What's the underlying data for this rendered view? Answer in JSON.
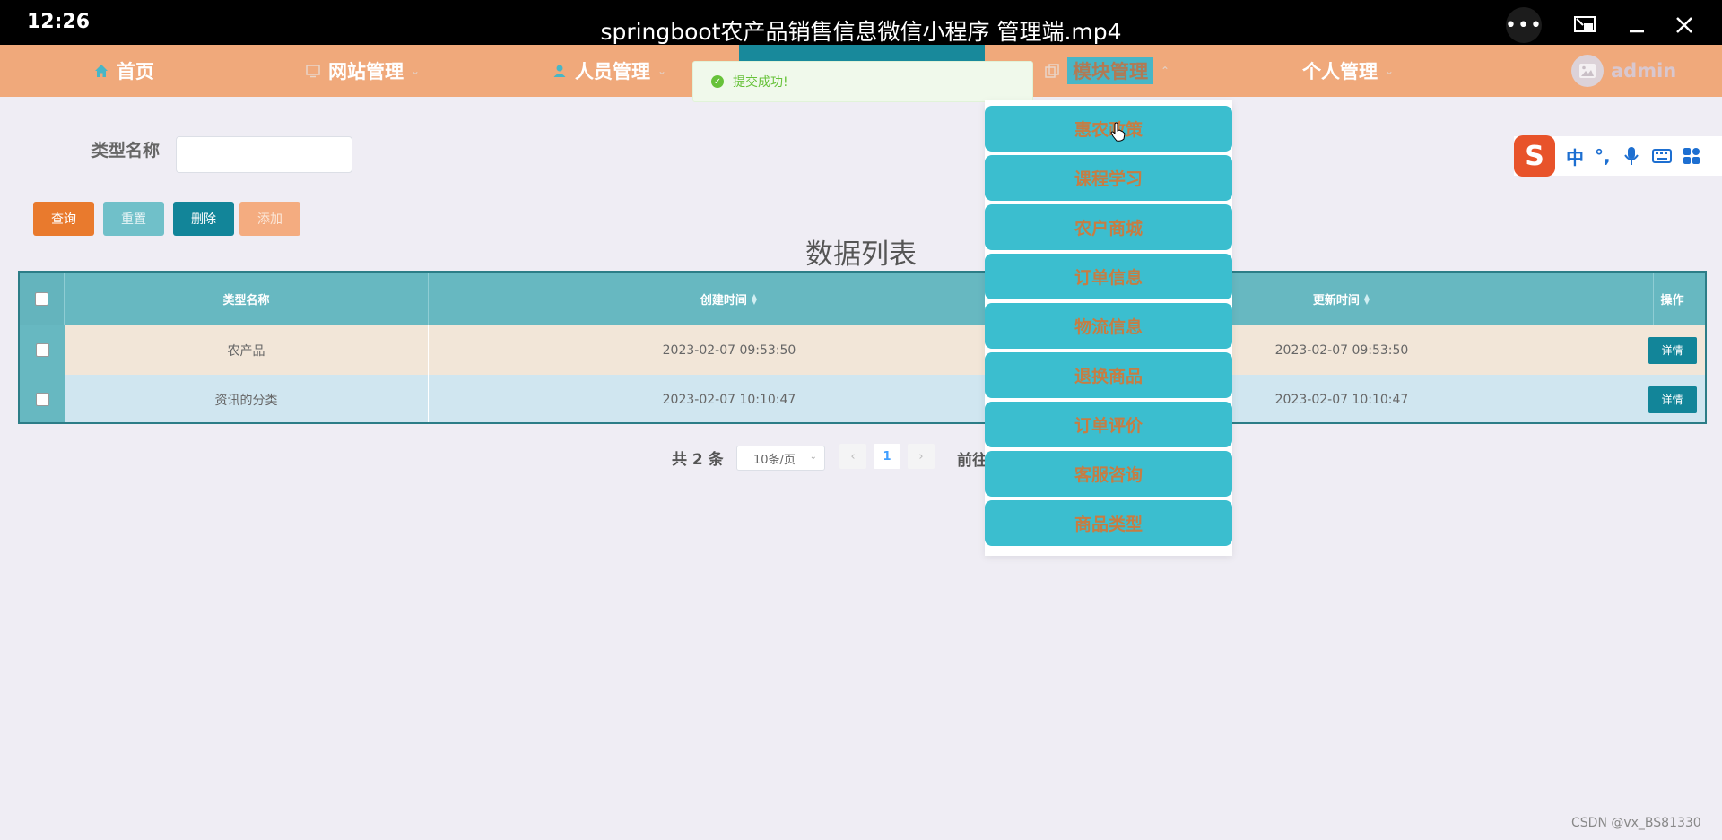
{
  "player": {
    "time": "12:26",
    "title": "springboot农产品销售信息微信小程序 管理端.mp4",
    "more_icon": "more-icon",
    "pip_icon": "picture-in-picture-icon",
    "minimize_icon": "minimize-icon",
    "close_icon": "close-icon"
  },
  "nav": {
    "items": [
      {
        "label": "首页",
        "icon": "home-icon"
      },
      {
        "label": "网站管理",
        "icon": "monitor-icon"
      },
      {
        "label": "人员管理",
        "icon": "user-icon"
      },
      {
        "label": "模块管理",
        "icon": "copy-icon"
      },
      {
        "label": "个人管理",
        "icon": ""
      }
    ],
    "user": "admin",
    "colors": {
      "bar": "#f0a97b",
      "active": "#18899b"
    }
  },
  "toast": {
    "text": "提交成功!"
  },
  "search": {
    "label": "类型名称",
    "value": ""
  },
  "buttons": {
    "query": "查询",
    "reset": "重置",
    "delete": "删除",
    "add": "添加"
  },
  "list_title": "数据列表",
  "table": {
    "headers": [
      "类型名称",
      "创建时间",
      "更新时间",
      "操作"
    ],
    "rows": [
      {
        "name": "农产品",
        "created": "2023-02-07 09:53:50",
        "updated": "2023-02-07 09:53:50",
        "action": "详情"
      },
      {
        "name": "资讯的分类",
        "created": "2023-02-07 10:10:47",
        "updated": "2023-02-07 10:10:47",
        "action": "详情"
      }
    ]
  },
  "pagination": {
    "total": "共 2 条",
    "page_size": "10条/页",
    "current": "1",
    "goto": "前往"
  },
  "dropdown": {
    "items": [
      "惠农政策",
      "课程学习",
      "农户商城",
      "订单信息",
      "物流信息",
      "退换商品",
      "订单评价",
      "客服咨询",
      "商品类型"
    ]
  },
  "ime": {
    "logo": "S",
    "items": [
      "中",
      "°,"
    ]
  },
  "watermark": "CSDN @vx_BS81330"
}
